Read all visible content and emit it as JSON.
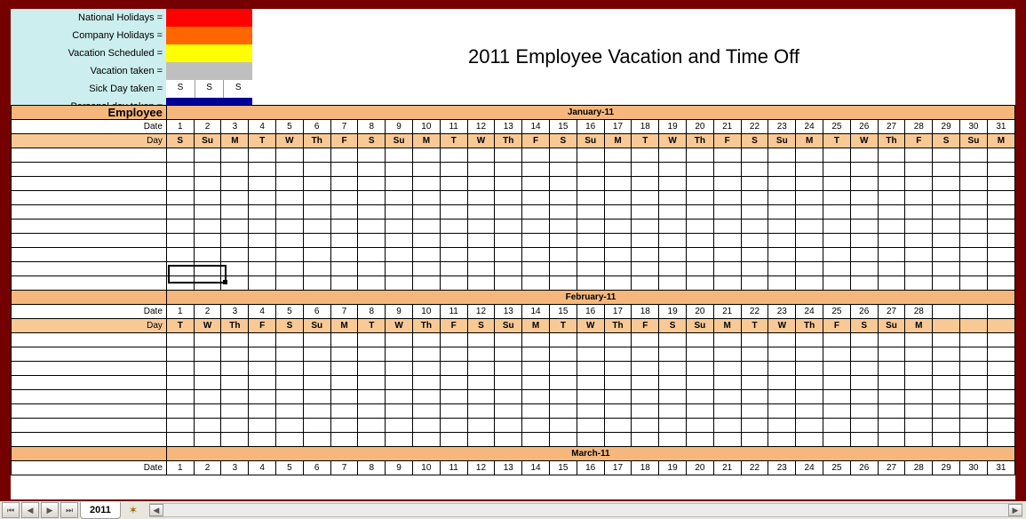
{
  "title": "2011 Employee Vacation and Time Off",
  "legend": [
    {
      "label": "National Holidays =",
      "color": "#ff0000",
      "text": ""
    },
    {
      "label": "Company Holidays =",
      "color": "#ff6600",
      "text": ""
    },
    {
      "label": "Vacation Scheduled =",
      "color": "#ffff00",
      "text": ""
    },
    {
      "label": "Vacation taken =",
      "color": "#bfbfbf",
      "text": ""
    },
    {
      "label": "Sick Day taken =",
      "color": "",
      "sick": [
        "S",
        "S",
        "S"
      ]
    },
    {
      "label": "Personal day taken =",
      "color": "#000099",
      "text": ""
    }
  ],
  "columns": {
    "employee": "Employee",
    "date": "Date",
    "day": "Day"
  },
  "months": [
    {
      "name": "January-11",
      "dates": [
        1,
        2,
        3,
        4,
        5,
        6,
        7,
        8,
        9,
        10,
        11,
        12,
        13,
        14,
        15,
        16,
        17,
        18,
        19,
        20,
        21,
        22,
        23,
        24,
        25,
        26,
        27,
        28,
        29,
        30,
        31
      ],
      "days": [
        "S",
        "Su",
        "M",
        "T",
        "W",
        "Th",
        "F",
        "S",
        "Su",
        "M",
        "T",
        "W",
        "Th",
        "F",
        "S",
        "Su",
        "M",
        "T",
        "W",
        "Th",
        "F",
        "S",
        "Su",
        "M",
        "T",
        "W",
        "Th",
        "F",
        "S",
        "Su",
        "M"
      ],
      "rows": 10
    },
    {
      "name": "February-11",
      "dates": [
        1,
        2,
        3,
        4,
        5,
        6,
        7,
        8,
        9,
        10,
        11,
        12,
        13,
        14,
        15,
        16,
        17,
        18,
        19,
        20,
        21,
        22,
        23,
        24,
        25,
        26,
        27,
        28
      ],
      "days": [
        "T",
        "W",
        "Th",
        "F",
        "S",
        "Su",
        "M",
        "T",
        "W",
        "Th",
        "F",
        "S",
        "Su",
        "M",
        "T",
        "W",
        "Th",
        "F",
        "S",
        "Su",
        "M",
        "T",
        "W",
        "Th",
        "F",
        "S",
        "Su",
        "M"
      ],
      "rows": 8
    },
    {
      "name": "March-11",
      "dates": [
        1,
        2,
        3,
        4,
        5,
        6,
        7,
        8,
        9,
        10,
        11,
        12,
        13,
        14,
        15,
        16,
        17,
        18,
        19,
        20,
        21,
        22,
        23,
        24,
        25,
        26,
        27,
        28,
        29,
        30,
        31
      ],
      "days": [],
      "rows": 0
    }
  ],
  "tab": {
    "name": "2011",
    "nav": [
      "⏮",
      "◀",
      "▶",
      "⏭"
    ]
  }
}
